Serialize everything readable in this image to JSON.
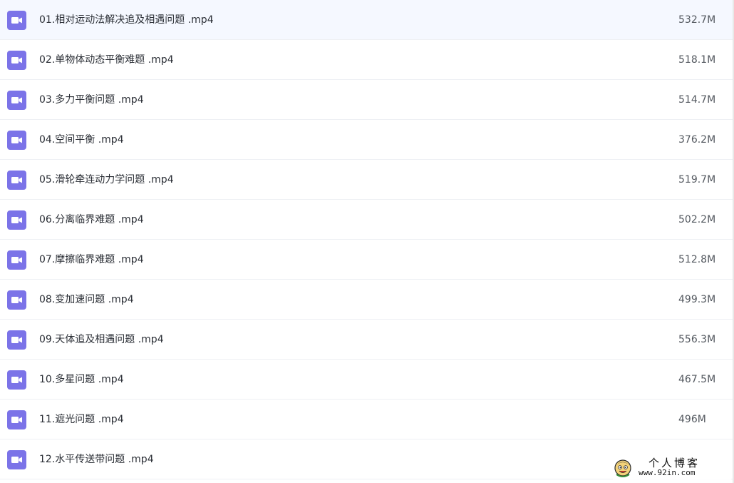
{
  "accent_color": "#7b73e8",
  "files": [
    {
      "name": "01.相对运动法解决追及相遇问题 .mp4",
      "size": "532.7M",
      "icon": "video-file-icon"
    },
    {
      "name": "02.单物体动态平衡难题 .mp4",
      "size": "518.1M",
      "icon": "video-file-icon"
    },
    {
      "name": "03.多力平衡问题 .mp4",
      "size": "514.7M",
      "icon": "video-file-icon"
    },
    {
      "name": "04.空间平衡 .mp4",
      "size": "376.2M",
      "icon": "video-file-icon"
    },
    {
      "name": "05.滑轮牵连动力学问题 .mp4",
      "size": "519.7M",
      "icon": "video-file-icon"
    },
    {
      "name": "06.分离临界难题 .mp4",
      "size": "502.2M",
      "icon": "video-file-icon"
    },
    {
      "name": "07.摩擦临界难题 .mp4",
      "size": "512.8M",
      "icon": "video-file-icon"
    },
    {
      "name": "08.变加速问题 .mp4",
      "size": "499.3M",
      "icon": "video-file-icon"
    },
    {
      "name": "09.天体追及相遇问题 .mp4",
      "size": "556.3M",
      "icon": "video-file-icon"
    },
    {
      "name": "10.多星问题 .mp4",
      "size": "467.5M",
      "icon": "video-file-icon"
    },
    {
      "name": "11.遮光问题 .mp4",
      "size": "496M",
      "icon": "video-file-icon"
    },
    {
      "name": "12.水平传送带问题 .mp4",
      "size": "",
      "icon": "video-file-icon"
    }
  ],
  "watermark": {
    "title": "个人博客",
    "url": "www.92in.com",
    "icon": "cartoon-face-icon"
  }
}
